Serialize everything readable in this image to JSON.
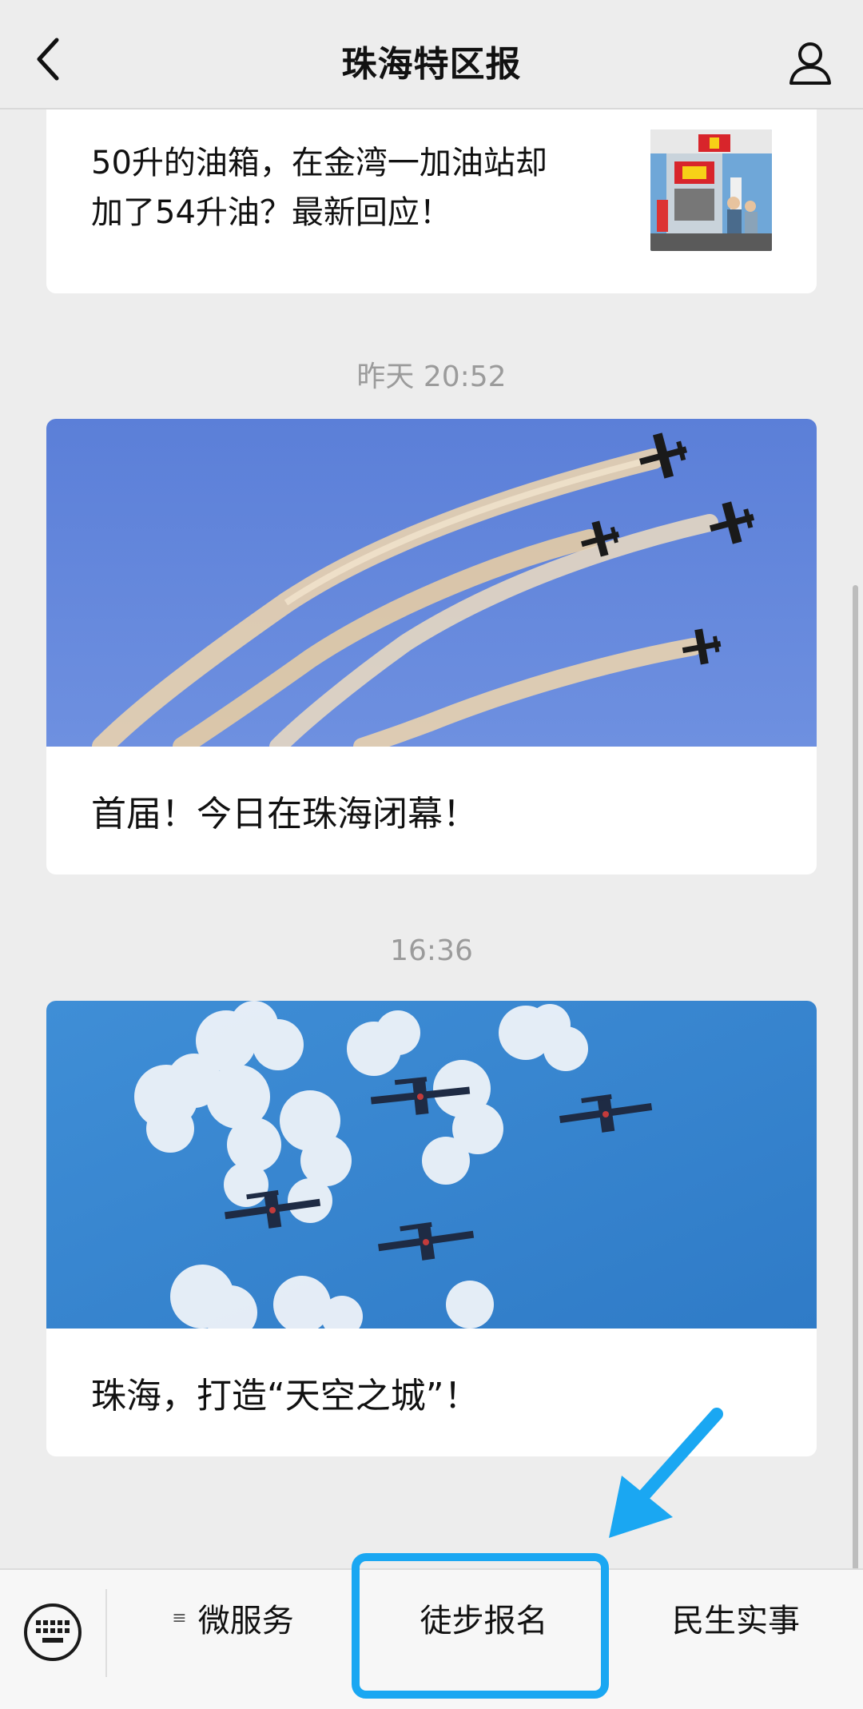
{
  "nav": {
    "title": "珠海特区报"
  },
  "feed": {
    "items": [
      {
        "title_line1": "50升的油箱，在金湾一加油站却",
        "title_line2": "加了54升油？最新回应！"
      },
      {
        "time": "昨天 20:52",
        "caption": "首届！今日在珠海闭幕！"
      },
      {
        "time": "16:36",
        "caption": "珠海，打造“天空之城”！"
      }
    ]
  },
  "bottom_menu": {
    "items": [
      {
        "label": "微服务",
        "has_submenu_icon": true
      },
      {
        "label": "徒步报名"
      },
      {
        "label": "民生实事"
      }
    ]
  },
  "annotation": {
    "highlight_color": "#1aa7f2"
  }
}
